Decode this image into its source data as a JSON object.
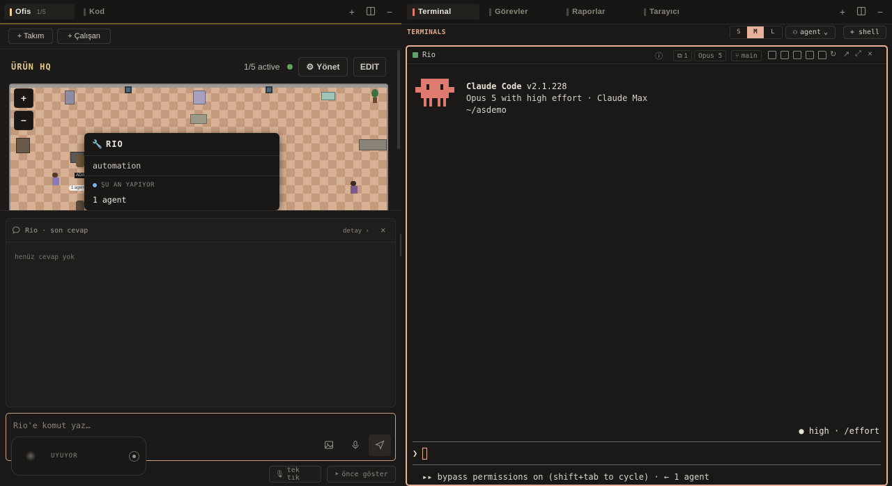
{
  "left": {
    "tabs": [
      {
        "label": "Ofis",
        "sub": "1/5",
        "active": true
      },
      {
        "label": "Kod",
        "active": false
      }
    ],
    "toolbar": {
      "team_button": "+ Takım",
      "employee_button": "+ Çalışan"
    },
    "office": {
      "title": "ÜRÜN HQ",
      "active_count": "1/5 active",
      "manage_button": "Yönet",
      "edit_button": "EDIT",
      "zoom_in": "+",
      "zoom_out": "−",
      "speech_bubble": "1 agent",
      "name_tag": "ADA"
    },
    "tooltip": {
      "name": "RIO",
      "role": "automation",
      "section_label": "ŞU AN YAPIYOR",
      "activity": "1 agent"
    },
    "chat": {
      "title": "Rio · son cevap",
      "detail_link": "detay",
      "empty_text": "henüz cevap yok"
    },
    "command": {
      "placeholder": "Rio'e komut yaz…",
      "status_text": "UYUYOR",
      "single_click_button": "tek tık",
      "preview_button": "önce göster"
    }
  },
  "right": {
    "tabs": [
      {
        "label": "Terminal",
        "active": true
      },
      {
        "label": "Görevler",
        "active": false
      },
      {
        "label": "Raporlar",
        "active": false
      },
      {
        "label": "Tarayıcı",
        "active": false
      }
    ],
    "section_title": "TERMINALS",
    "sizes": [
      "S",
      "M",
      "L"
    ],
    "selected_size": "M",
    "agent_select": "agent",
    "shell_button": "+ shell",
    "terminal": {
      "name": "Rio",
      "count_chip": "1",
      "model_chip": "Opus 5",
      "branch_chip": "main",
      "app_name": "Claude Code",
      "version": "v2.1.228",
      "model_line": "Opus 5 with high effort · Claude Max",
      "cwd": "~/asdemo",
      "effort_line": "● high · /effort",
      "prompt_symbol": "❯",
      "footer": "▸▸ bypass permissions on (shift+tab to cycle) · ← 1 agent"
    }
  },
  "colors": {
    "accent": "#e8b29b",
    "title_gold": "#e0c98a",
    "mascot": "#e07a6e",
    "status_green": "#5fa36a",
    "tab_marker": "#f0d08a"
  }
}
